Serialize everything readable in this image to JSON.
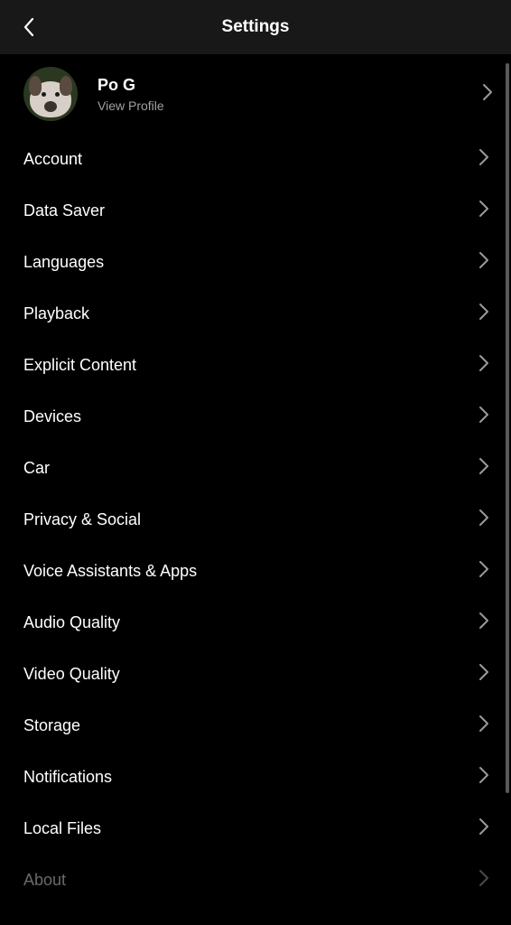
{
  "header": {
    "title": "Settings"
  },
  "profile": {
    "name": "Po G",
    "subtitle": "View Profile"
  },
  "items": [
    {
      "label": "Account"
    },
    {
      "label": "Data Saver"
    },
    {
      "label": "Languages"
    },
    {
      "label": "Playback"
    },
    {
      "label": "Explicit Content"
    },
    {
      "label": "Devices"
    },
    {
      "label": "Car"
    },
    {
      "label": "Privacy & Social"
    },
    {
      "label": "Voice Assistants & Apps"
    },
    {
      "label": "Audio Quality"
    },
    {
      "label": "Video Quality"
    },
    {
      "label": "Storage"
    },
    {
      "label": "Notifications"
    },
    {
      "label": "Local Files"
    },
    {
      "label": "About"
    }
  ]
}
